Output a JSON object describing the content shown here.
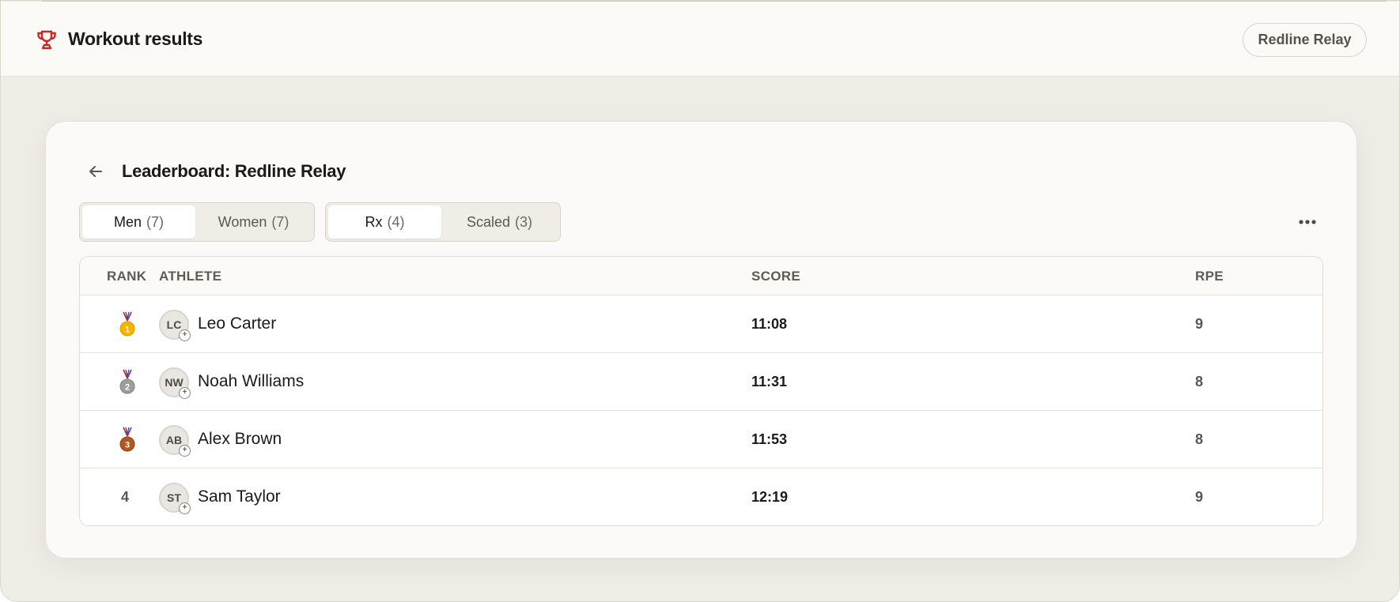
{
  "header": {
    "title": "Workout results",
    "event_pill": "Redline Relay",
    "brand_color": "#c62828"
  },
  "card": {
    "title": "Leaderboard: Redline Relay",
    "gender_tabs": [
      {
        "label": "Men",
        "count": "(7)",
        "active": true
      },
      {
        "label": "Women",
        "count": "(7)",
        "active": false
      }
    ],
    "division_tabs": [
      {
        "label": "Rx",
        "count": "(4)",
        "active": true
      },
      {
        "label": "Scaled",
        "count": "(3)",
        "active": false
      }
    ]
  },
  "table": {
    "columns": [
      "RANK",
      "ATHLETE",
      "SCORE",
      "RPE"
    ],
    "rows": [
      {
        "rank": "1",
        "medal": "gold",
        "initials": "LC",
        "name": "Leo Carter",
        "score": "11:08",
        "rpe": "9"
      },
      {
        "rank": "2",
        "medal": "silver",
        "initials": "NW",
        "name": "Noah Williams",
        "score": "11:31",
        "rpe": "8"
      },
      {
        "rank": "3",
        "medal": "bronze",
        "initials": "AB",
        "name": "Alex Brown",
        "score": "11:53",
        "rpe": "8"
      },
      {
        "rank": "4",
        "medal": null,
        "initials": "ST",
        "name": "Sam Taylor",
        "score": "12:19",
        "rpe": "9"
      }
    ]
  },
  "colors": {
    "gold": "#f4b400",
    "silver": "#9e9e9e",
    "bronze": "#b5541f"
  }
}
